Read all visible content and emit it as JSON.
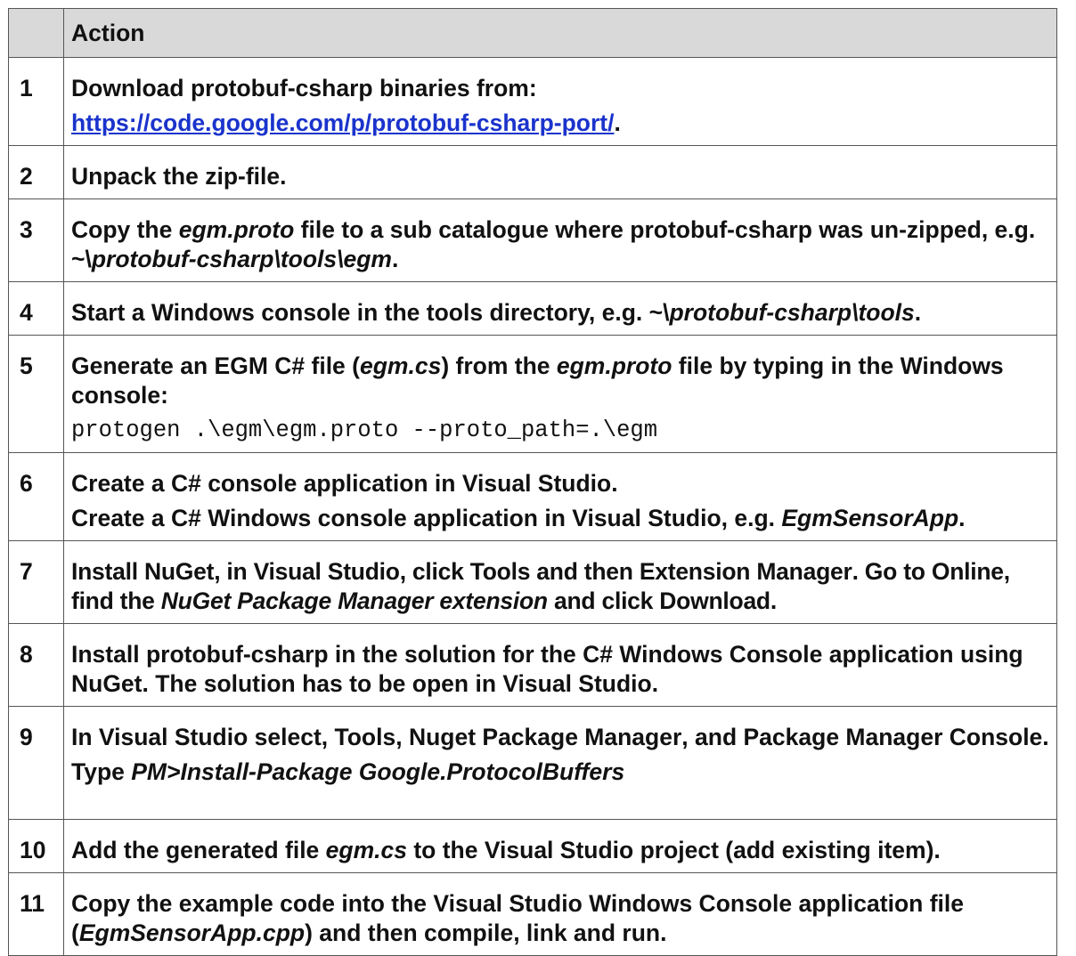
{
  "header": {
    "num_label": "",
    "action_label": "Action"
  },
  "rows": [
    {
      "num": "1",
      "p1": "Download protobuf-csharp binaries from:",
      "link": "https://code.google.com/p/protobuf-csharp-port/",
      "link_tail": "."
    },
    {
      "num": "2",
      "p1": "Unpack the zip-file."
    },
    {
      "num": "3",
      "a": "Copy the ",
      "b": "egm.proto",
      "c": " file to a sub catalogue where protobuf-csharp was un-zipped, e.g. ~\\",
      "d": "protobuf-csharp\\tools\\egm",
      "e": "."
    },
    {
      "num": "4",
      "a": "Start a Windows console in the tools directory, e.g. ~\\",
      "b": "protobuf-csharp\\tools",
      "c": "."
    },
    {
      "num": "5",
      "a": "Generate an EGM C# file (",
      "b": "egm.cs",
      "c": ") from the ",
      "d": "egm.proto",
      "e": " file by typing in the Windows console:",
      "code": "protogen .\\egm\\egm.proto --proto_path=.\\egm"
    },
    {
      "num": "6",
      "p1": "Create a C# console application in Visual Studio.",
      "a": "Create a C# Windows console application in Visual Studio, e.g. ",
      "b": "EgmSensorApp",
      "c": "."
    },
    {
      "num": "7",
      "a": "Install NuGet, in Visual Studio, click ",
      "b": "Tools",
      "c": " and then ",
      "d": "Extension Manager",
      "e": ". Go to ",
      "f": "Online",
      "g": ", find the ",
      "h": "NuGet Package Manager extension",
      "i": " and click ",
      "j": "Download",
      "k": "."
    },
    {
      "num": "8",
      "p1": "Install protobuf-csharp in the solution for the C# Windows Console application using NuGet. The solution has to be open in Visual Studio."
    },
    {
      "num": "9",
      "a": "In Visual Studio select, ",
      "b": "Tools",
      "c": ", ",
      "d": "Nuget Package Manager",
      "e": ", and ",
      "f": "Package Manager Console",
      "g": ".",
      "t1": "Type ",
      "t2": "PM>Install-Package Google.ProtocolBuffers"
    },
    {
      "num": "10",
      "a": "Add the generated file ",
      "b": "egm.cs",
      "c": " to the Visual Studio project (add existing item)."
    },
    {
      "num": "11",
      "a": "Copy the example code into the Visual Studio Windows Console application file (",
      "b": "EgmSensorApp.cpp",
      "c": ") and then compile, link and run."
    }
  ]
}
